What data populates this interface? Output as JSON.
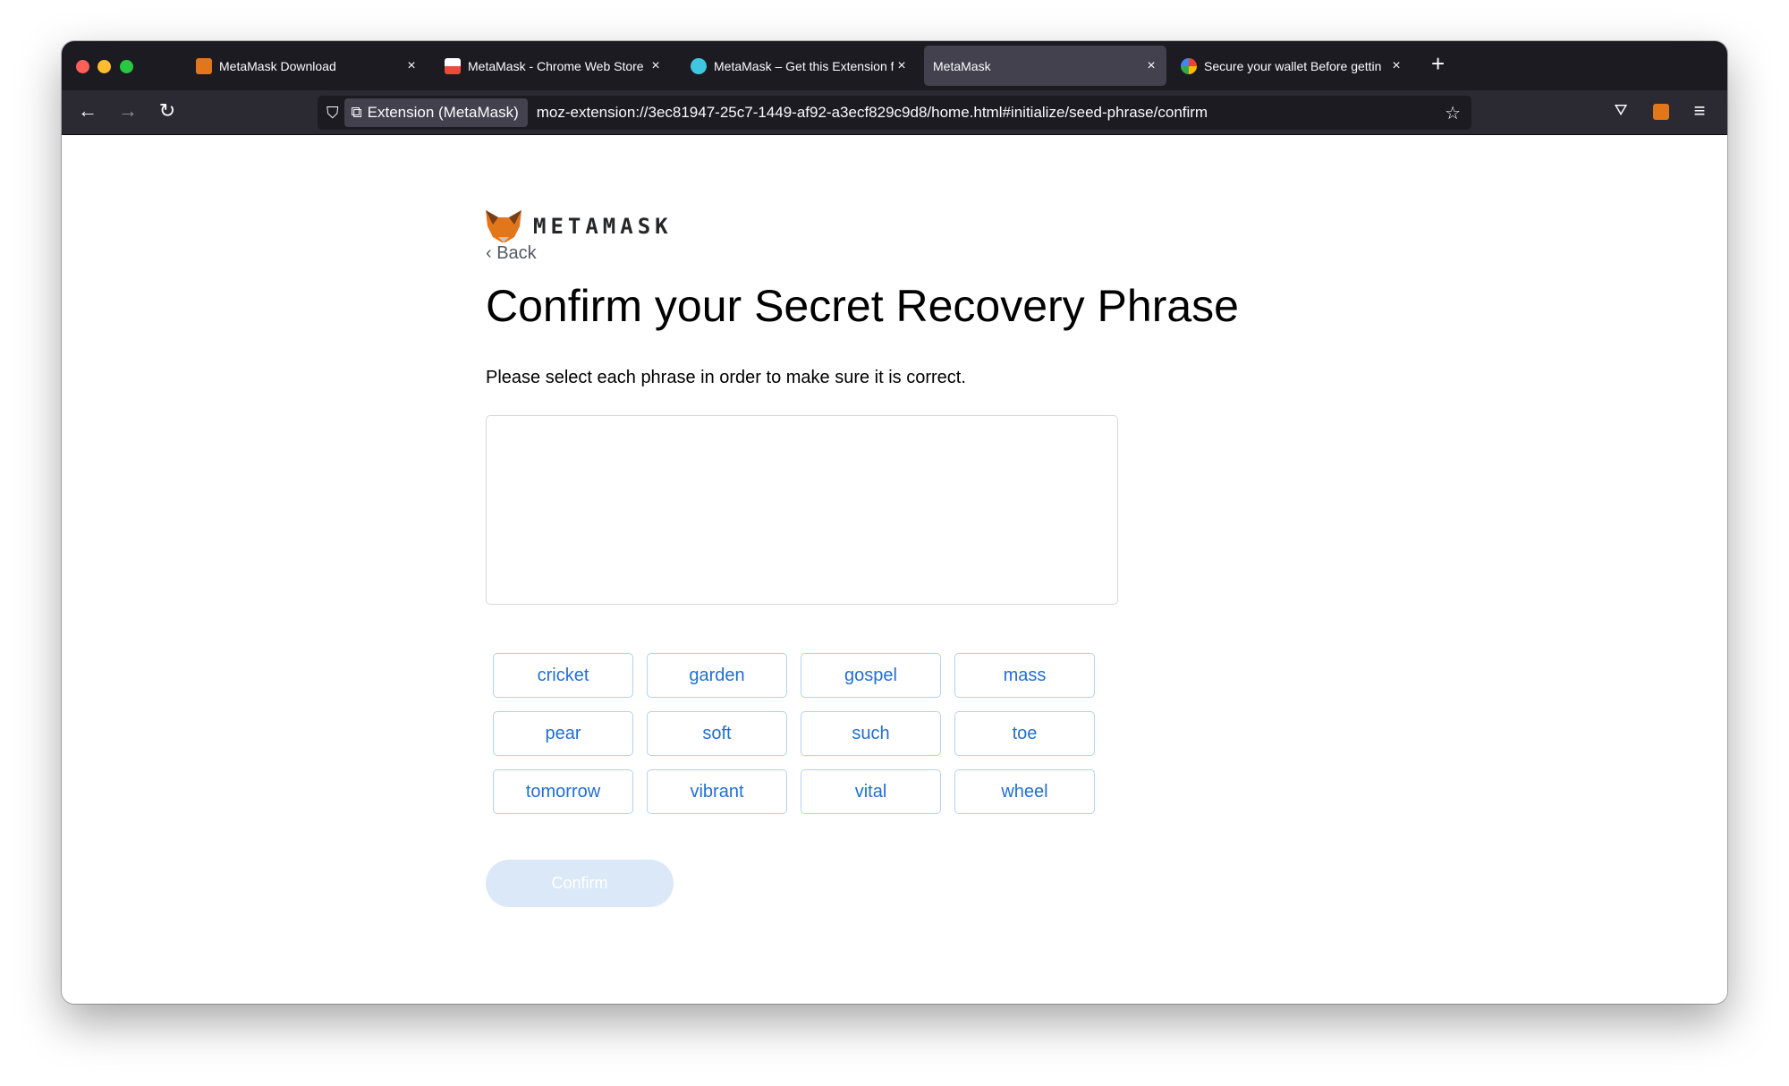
{
  "browser": {
    "tabs": [
      {
        "title": "MetaMask Download",
        "icon": "metamask-fox-icon",
        "active": false
      },
      {
        "title": "MetaMask - Chrome Web Store",
        "icon": "chrome-web-store-icon",
        "active": false
      },
      {
        "title": "MetaMask – Get this Extension f",
        "icon": "firefox-addon-icon",
        "active": false
      },
      {
        "title": "MetaMask",
        "icon": "",
        "active": true
      },
      {
        "title": "Secure your wallet Before gettin",
        "icon": "google-icon",
        "active": false
      }
    ],
    "close_glyph": "×",
    "new_tab_glyph": "+",
    "identity_label": "Extension (MetaMask)",
    "url": "moz-extension://3ec81947-25c7-1449-af92-a3ecf829c9d8/home.html#initialize/seed-phrase/confirm"
  },
  "page": {
    "logo_text": "METAMASK",
    "back_label": "‹ Back",
    "title": "Confirm your Secret Recovery Phrase",
    "instructions": "Please select each phrase in order to make sure it is correct.",
    "words": [
      "cricket",
      "garden",
      "gospel",
      "mass",
      "pear",
      "soft",
      "such",
      "toe",
      "tomorrow",
      "vibrant",
      "vital",
      "wheel"
    ],
    "confirm_label": "Confirm",
    "confirm_disabled": true
  },
  "colors": {
    "accent": "#1f6fd6",
    "word_border": "#b4d2f2",
    "confirm_disabled_bg": "#dbe8f7"
  }
}
